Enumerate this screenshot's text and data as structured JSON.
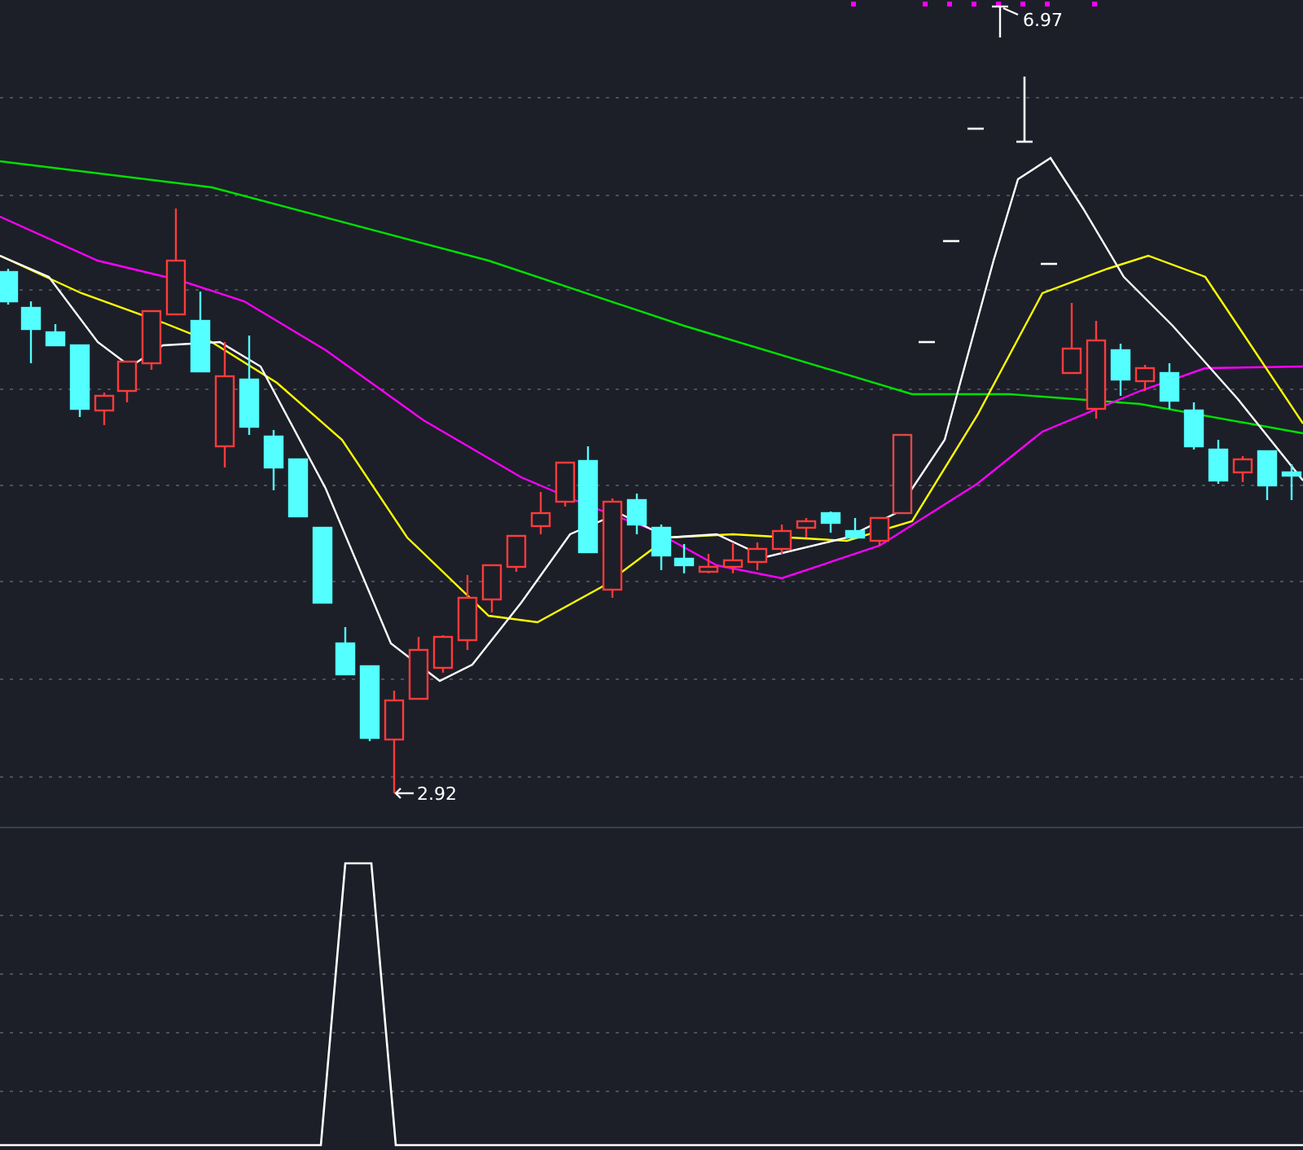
{
  "price_chart": {
    "high_marker": "6.97",
    "low_marker": "2.92"
  }
}
